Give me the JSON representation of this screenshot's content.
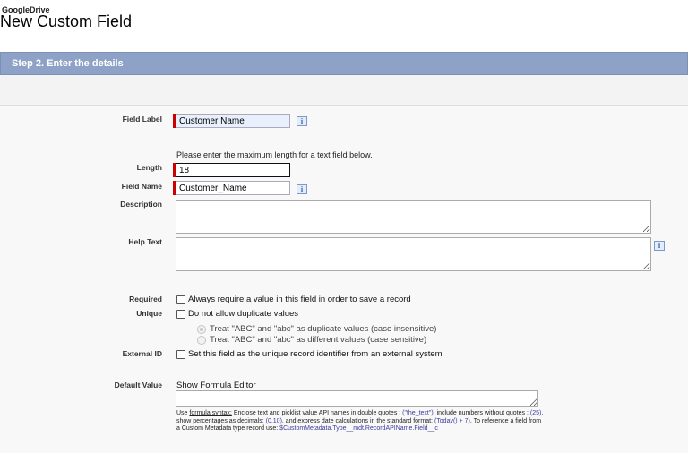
{
  "header": {
    "app_name": "GoogleDrive",
    "title": "New Custom Field"
  },
  "step": {
    "title": "Step 2. Enter the details"
  },
  "form": {
    "field_label": {
      "label": "Field Label",
      "value": "Customer Name",
      "info": "i"
    },
    "length_hint": "Please enter the maximum length for a text field below.",
    "length": {
      "label": "Length",
      "value": "18"
    },
    "field_name": {
      "label": "Field Name",
      "value": "Customer_Name",
      "info": "i"
    },
    "description": {
      "label": "Description",
      "value": ""
    },
    "help_text": {
      "label": "Help Text",
      "value": "",
      "info": "i"
    },
    "required": {
      "label": "Required",
      "option": "Always require a value in this field in order to save a record",
      "checked": false
    },
    "unique": {
      "label": "Unique",
      "option": "Do not allow duplicate values",
      "checked": false,
      "radios": [
        {
          "text": "Treat \"ABC\" and \"abc\" as duplicate values (case insensitive)",
          "selected": true
        },
        {
          "text": "Treat \"ABC\" and \"abc\" as different values (case sensitive)",
          "selected": false
        }
      ]
    },
    "external_id": {
      "label": "External ID",
      "option": "Set this field as the unique record identifier from an external system",
      "checked": false
    },
    "default_value": {
      "label": "Default Value",
      "link": "Show Formula Editor",
      "value": "",
      "note": {
        "use": "Use ",
        "formula_syntax": "formula syntax:",
        "p1": " Enclose text and picklist value API names in double quotes : ",
        "c1": "(\"the_text\")",
        "p2": ", include numbers without quotes : ",
        "c2": "(25)",
        "p3": ", show percentages as decimals: ",
        "c3": "(0.10)",
        "p4": ", and express date calculations in the standard format: ",
        "c4": "(Today() + 7)",
        "p5": ", To reference a field from a Custom Metadata type record use: ",
        "c5": "$CustomMetadata.Type__mdt.RecordAPIName.Field__c"
      }
    }
  }
}
